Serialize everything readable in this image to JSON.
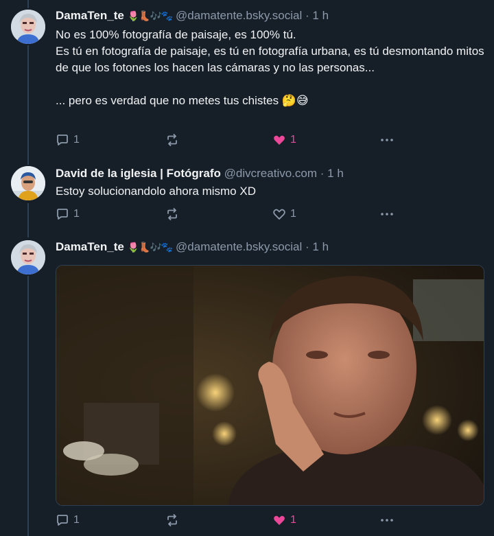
{
  "posts": [
    {
      "author": "DamaTen_te",
      "emoji": "🌷👢🎶🐾",
      "handle": "@damatente.bsky.social",
      "dot": "·",
      "time": "1 h",
      "text": "No es 100% fotografía de paisaje, es 100% tú.\nEs tú en fotografía de paisaje, es tú en fotografía urbana, es tú desmontando mitos de que los fotones los hacen las cámaras y no las personas...\n\n... pero es verdad que no metes tus chistes 🤔😅",
      "replies": "1",
      "reposts": "",
      "likes": "1",
      "liked": true
    },
    {
      "author": "David de la iglesia | Fotógrafo",
      "emoji": "",
      "handle": "@divcreativo.com",
      "dot": "·",
      "time": "1 h",
      "text": "Estoy solucionandolo ahora mismo XD",
      "replies": "1",
      "reposts": "",
      "likes": "1",
      "liked": false
    },
    {
      "author": "DamaTen_te",
      "emoji": "🌷👢🎶🐾",
      "handle": "@damatente.bsky.social",
      "dot": "·",
      "time": "1 h",
      "text": "",
      "media": "gif-image",
      "replies": "1",
      "reposts": "",
      "likes": "1",
      "liked": true
    }
  ],
  "colors": {
    "background": "#161e27",
    "text": "#f1f3f5",
    "muted": "#8c9aab",
    "like": "#ec4899",
    "thread_line": "#2e4052"
  },
  "icons": [
    "reply-icon",
    "repost-icon",
    "heart-icon",
    "more-icon"
  ]
}
